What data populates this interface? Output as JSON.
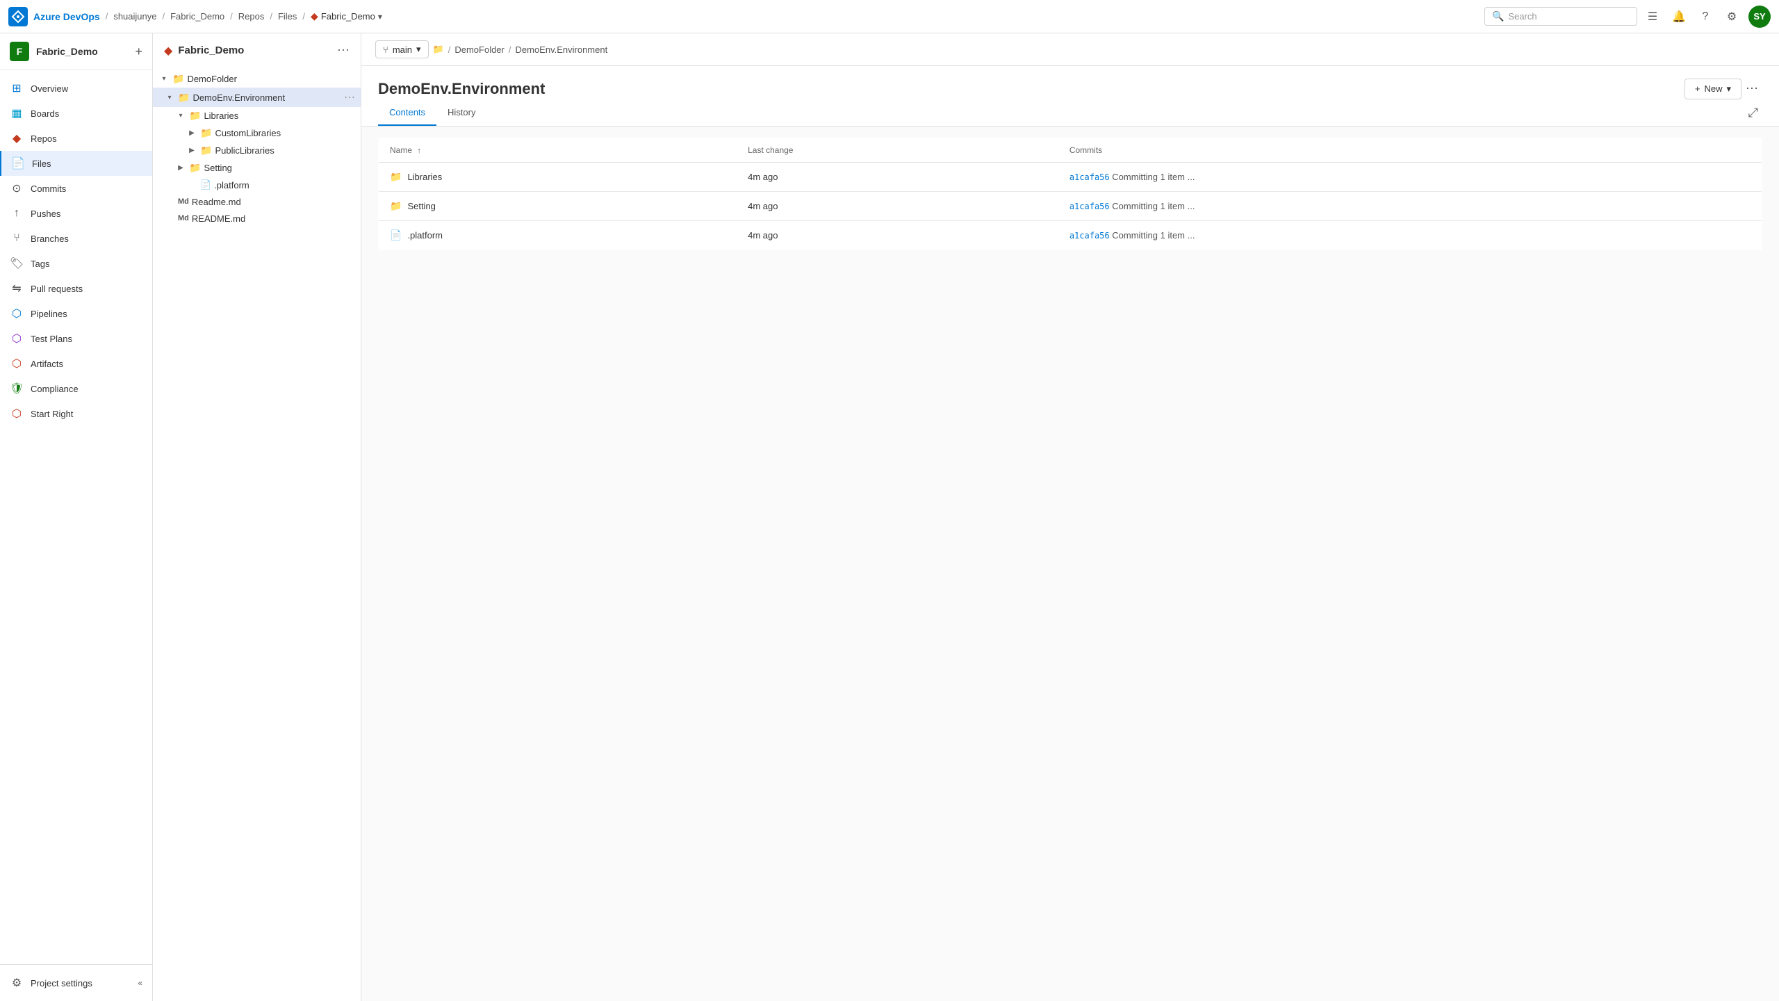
{
  "topNav": {
    "logo": "A",
    "brand": "Azure DevOps",
    "breadcrumbs": [
      {
        "label": "shuaijunye",
        "active": false
      },
      {
        "label": "Fabric_Demo",
        "active": false
      },
      {
        "label": "Repos",
        "active": false
      },
      {
        "label": "Files",
        "active": false
      },
      {
        "label": "Fabric_Demo",
        "active": true
      }
    ],
    "search": {
      "placeholder": "Search"
    },
    "avatar": "SY"
  },
  "projectSidebar": {
    "projectIcon": "F",
    "projectName": "Fabric_Demo",
    "addLabel": "+",
    "items": [
      {
        "label": "Overview",
        "icon": "overview",
        "active": false
      },
      {
        "label": "Boards",
        "icon": "boards",
        "active": false
      },
      {
        "label": "Repos",
        "icon": "repos",
        "active": false
      },
      {
        "label": "Files",
        "icon": "files",
        "active": true
      },
      {
        "label": "Commits",
        "icon": "commits",
        "active": false
      },
      {
        "label": "Pushes",
        "icon": "pushes",
        "active": false
      },
      {
        "label": "Branches",
        "icon": "branches",
        "active": false
      },
      {
        "label": "Tags",
        "icon": "tags",
        "active": false
      },
      {
        "label": "Pull requests",
        "icon": "pullrequests",
        "active": false
      },
      {
        "label": "Pipelines",
        "icon": "pipelines",
        "active": false
      },
      {
        "label": "Test Plans",
        "icon": "testplans",
        "active": false
      },
      {
        "label": "Artifacts",
        "icon": "artifacts",
        "active": false
      },
      {
        "label": "Compliance",
        "icon": "compliance",
        "active": false
      },
      {
        "label": "Start Right",
        "icon": "startright",
        "active": false
      }
    ],
    "footer": [
      {
        "label": "Project settings",
        "icon": "settings"
      }
    ]
  },
  "fileTree": {
    "repoName": "Fabric_Demo",
    "items": [
      {
        "label": "DemoFolder",
        "type": "folder",
        "indent": 0,
        "expanded": true,
        "selected": false
      },
      {
        "label": "DemoEnv.Environment",
        "type": "folder",
        "indent": 1,
        "expanded": true,
        "selected": true,
        "hasMore": true
      },
      {
        "label": "Libraries",
        "type": "folder",
        "indent": 2,
        "expanded": true,
        "selected": false
      },
      {
        "label": "CustomLibraries",
        "type": "folder",
        "indent": 3,
        "expanded": false,
        "selected": false
      },
      {
        "label": "PublicLibraries",
        "type": "folder",
        "indent": 3,
        "expanded": false,
        "selected": false
      },
      {
        "label": "Setting",
        "type": "folder",
        "indent": 2,
        "expanded": false,
        "selected": false
      },
      {
        "label": ".platform",
        "type": "file",
        "indent": 3,
        "selected": false
      },
      {
        "label": "Readme.md",
        "type": "md",
        "indent": 1,
        "selected": false
      },
      {
        "label": "README.md",
        "type": "md",
        "indent": 1,
        "selected": false
      }
    ]
  },
  "mainContent": {
    "branch": "main",
    "breadcrumbFolder": "DemoFolder",
    "breadcrumbFile": "DemoEnv.Environment",
    "title": "DemoEnv.Environment",
    "newButton": "New",
    "tabs": [
      {
        "label": "Contents",
        "active": true
      },
      {
        "label": "History",
        "active": false
      }
    ],
    "table": {
      "columns": [
        {
          "label": "Name",
          "sortable": true
        },
        {
          "label": "Last change"
        },
        {
          "label": "Commits"
        }
      ],
      "rows": [
        {
          "icon": "folder",
          "name": "Libraries",
          "lastChange": "4m ago",
          "commitHash": "a1cafa56",
          "commitMsg": "Committing 1 item ..."
        },
        {
          "icon": "folder",
          "name": "Setting",
          "lastChange": "4m ago",
          "commitHash": "a1cafa56",
          "commitMsg": "Committing 1 item ..."
        },
        {
          "icon": "file",
          "name": ".platform",
          "lastChange": "4m ago",
          "commitHash": "a1cafa56",
          "commitMsg": "Committing 1 item ..."
        }
      ]
    }
  }
}
